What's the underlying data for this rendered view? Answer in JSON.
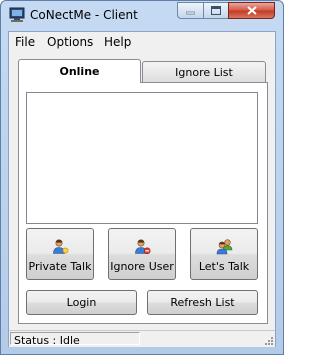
{
  "window": {
    "title": "CoNectMe - Client",
    "buttons": [
      "minimize",
      "maximize",
      "close"
    ]
  },
  "menu": [
    {
      "label": "File"
    },
    {
      "label": "Options"
    },
    {
      "label": "Help"
    }
  ],
  "tabs": [
    {
      "label": "Online",
      "selected": true
    },
    {
      "label": "Ignore List",
      "selected": false
    }
  ],
  "online_list": [],
  "actions": [
    {
      "label": "Private Talk",
      "icon": "user-chat-icon"
    },
    {
      "label": "Ignore User",
      "icon": "user-block-icon"
    },
    {
      "label": "Let's Talk",
      "icon": "users-group-icon"
    }
  ],
  "login_label": "Login",
  "refresh_label": "Refresh List",
  "status": "Status : Idle",
  "colors": {
    "title_bar": "#c5daf2",
    "close_button": "#c43d26",
    "face": "#f0f0f0"
  }
}
